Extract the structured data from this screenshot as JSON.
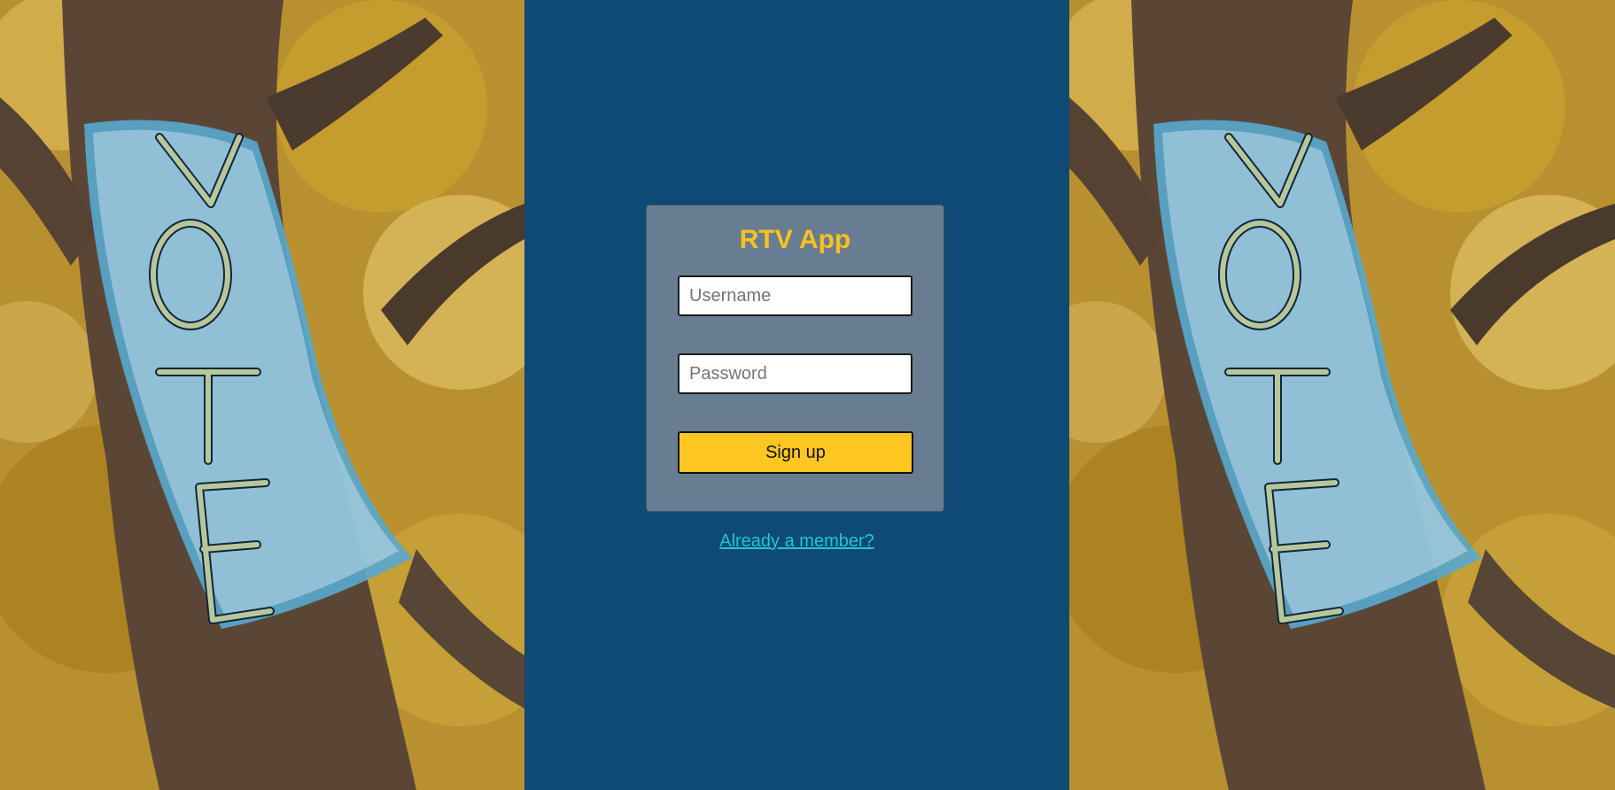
{
  "app": {
    "title": "RTV App"
  },
  "form": {
    "username_placeholder": "Username",
    "password_placeholder": "Password",
    "submit_label": "Sign up"
  },
  "links": {
    "already_member": "Already a member?"
  },
  "colors": {
    "page_background": "#0e4a75",
    "card_background": "#687d91",
    "title": "#fdc11f",
    "button": "#fdc620",
    "link": "#22c5cf"
  },
  "images": {
    "left": "tree-with-knitted-vote-sleeve",
    "right": "tree-with-knitted-vote-sleeve"
  }
}
